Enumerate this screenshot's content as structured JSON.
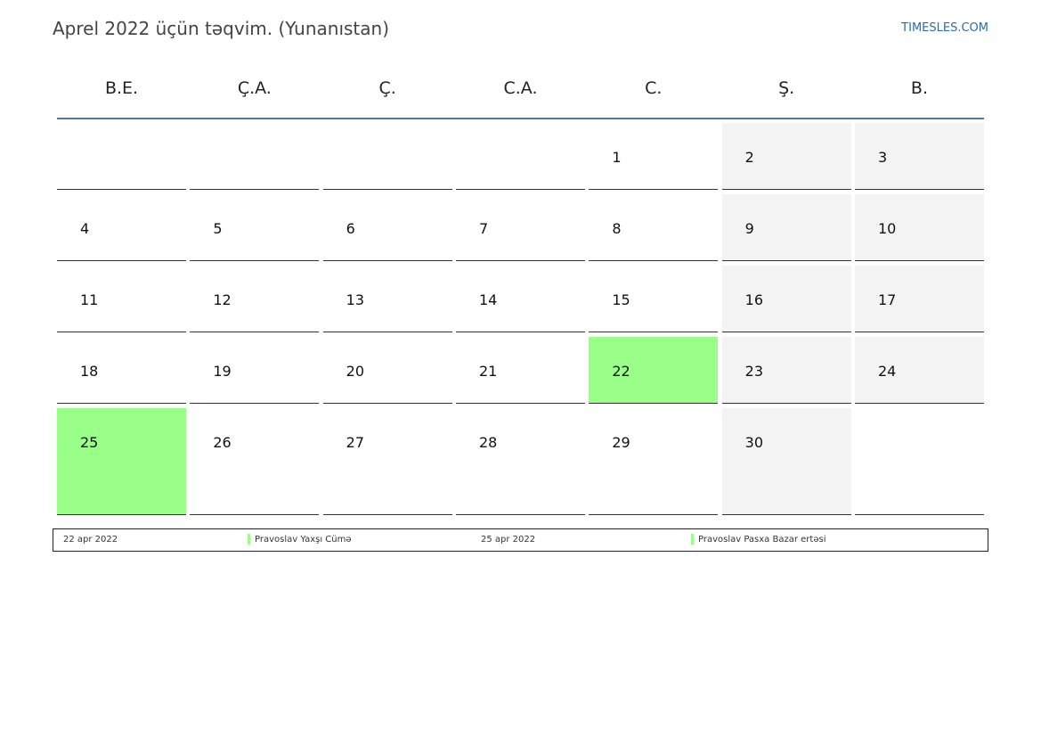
{
  "header": {
    "title": "Aprel 2022 üçün təqvim. (Yunanıstan)",
    "brand": "TIMESLES.COM"
  },
  "weekdays": [
    "B.E.",
    "Ç.A.",
    "Ç.",
    "C.A.",
    "C.",
    "Ş.",
    "B."
  ],
  "colors": {
    "holiday": "#99ff88",
    "weekend": "#f3f3f3",
    "header_rule": "#5a7698",
    "brand": "#2a6db0"
  },
  "weeks": [
    [
      "",
      "",
      "",
      "",
      "1",
      "2",
      "3"
    ],
    [
      "4",
      "5",
      "6",
      "7",
      "8",
      "9",
      "10"
    ],
    [
      "11",
      "12",
      "13",
      "14",
      "15",
      "16",
      "17"
    ],
    [
      "18",
      "19",
      "20",
      "21",
      "22",
      "23",
      "24"
    ],
    [
      "25",
      "26",
      "27",
      "28",
      "29",
      "30",
      ""
    ]
  ],
  "holidays": [
    "22",
    "25"
  ],
  "legend": [
    {
      "date": "22 apr 2022",
      "name": "Pravoslav Yaxşı Cümə"
    },
    {
      "date": "25 apr 2022",
      "name": "Pravoslav Pasxa Bazar ertəsi"
    }
  ]
}
